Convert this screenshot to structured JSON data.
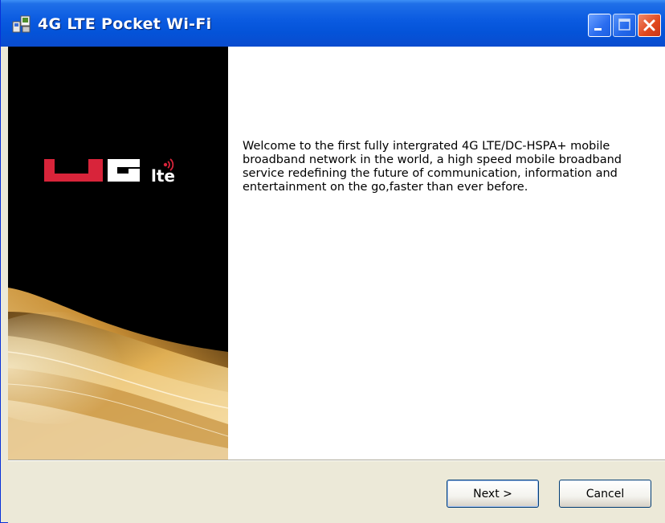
{
  "window": {
    "title": "4G LTE Pocket Wi-Fi",
    "icon": "installer-icon"
  },
  "banner": {
    "logo_text": "4G",
    "logo_sub": "lte",
    "logo_icon": "wireless-signal-icon"
  },
  "main": {
    "welcome_text": "Welcome to the first fully intergrated 4G LTE/DC-HSPA+ mobile broadband network in the world, a high speed mobile broadband service redefining the future of communication, information and entertainment on the go,faster than ever before."
  },
  "buttons": {
    "next_label": "Next >",
    "cancel_label": "Cancel"
  },
  "colors": {
    "titlebar": "#0a5ae0",
    "logo_red": "#d8243a",
    "logo_white": "#ffffff",
    "swoosh_gold": "#d9a648"
  }
}
